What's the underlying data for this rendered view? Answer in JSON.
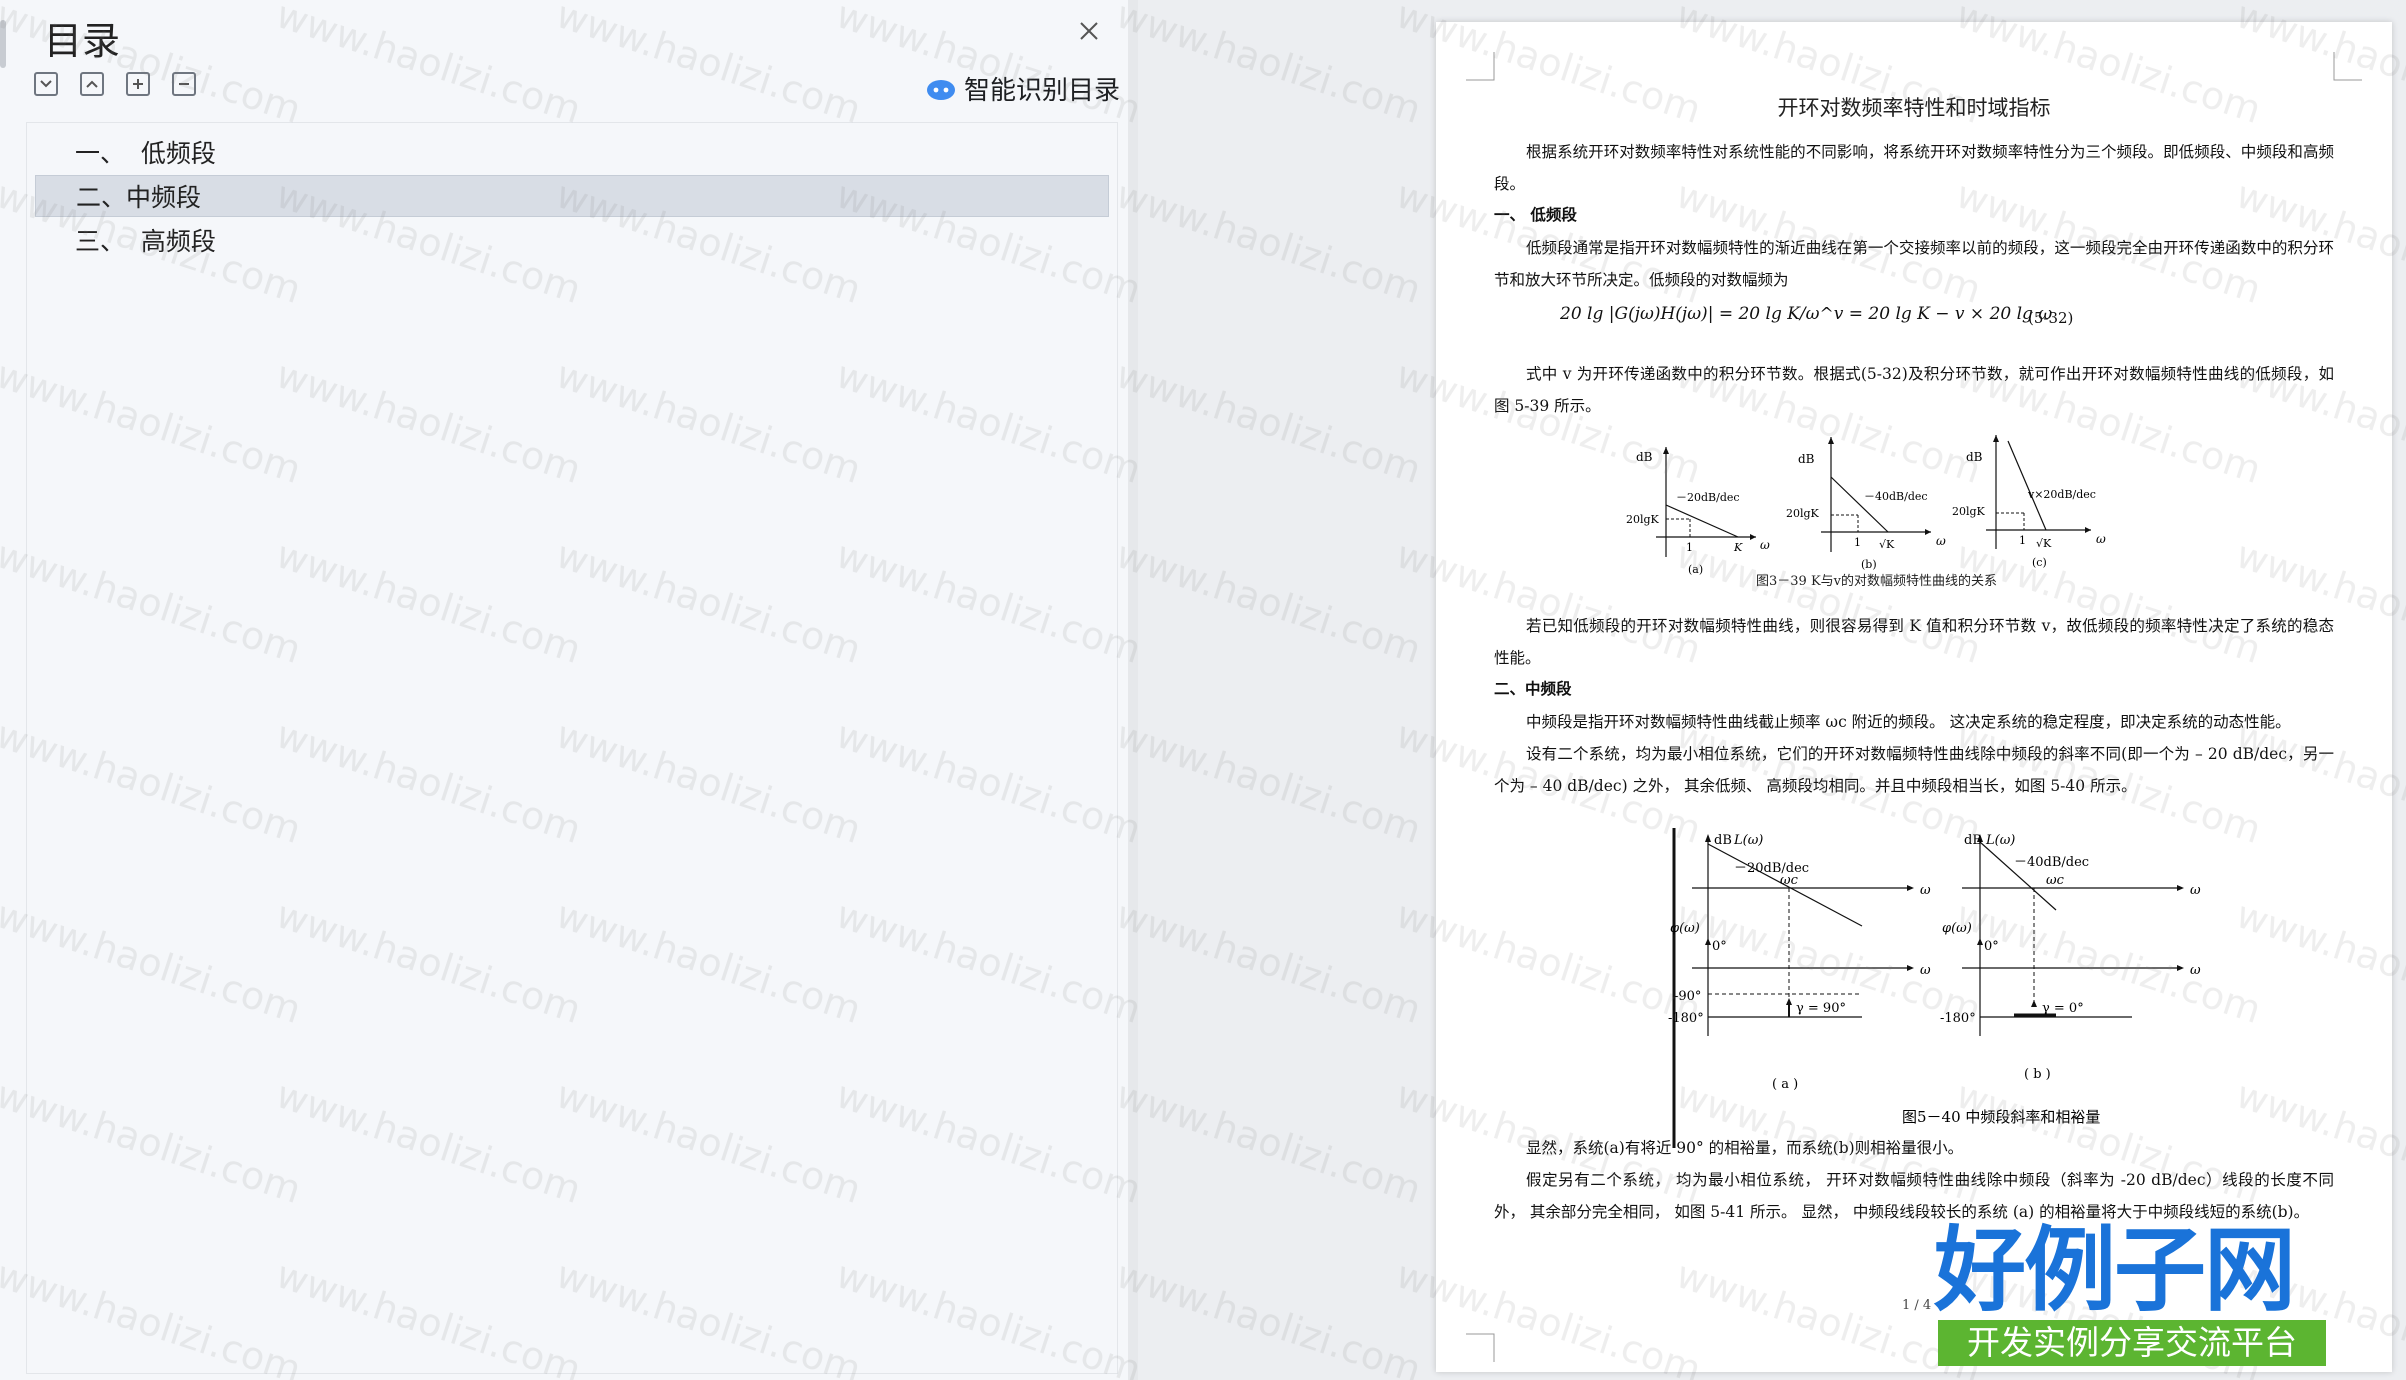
{
  "toc": {
    "title": "目录",
    "smart_toc_label": "智能识别目录",
    "items": [
      {
        "label": "一、  低频段"
      },
      {
        "label": "二、中频段"
      },
      {
        "label": "三、  高频段"
      }
    ],
    "active_index": 1
  },
  "document": {
    "title": "开环对数频率特性和时域指标",
    "intro": "根据系统开环对数频率特性对系统性能的不同影响，将系统开环对数频率特性分为三个频段。即低频段、中频段和高频段。",
    "h1": "一、  低频段",
    "p1": "低频段通常是指开环对数幅频特性的渐近曲线在第一个交接频率以前的频段，这一频段完全由开环传递函数中的积分环节和放大环节所决定。低频段的对数幅频为",
    "formula": "20 lg |G(jω)H(jω)| = 20 lg K/ω^v = 20 lg K − v × 20 lg ω",
    "eq_no": "(5-32)",
    "p2": "式中 v 为开环传递函数中的积分环节数。根据式(5-32)及积分环节数，就可作出开环对数幅频特性曲线的低频段，如图 5-39 所示。",
    "fig39": {
      "caption": "图3－39  K与v的对数幅频特性曲线的关系",
      "panels": [
        {
          "label": "(a)",
          "slope": "－20dB/dec",
          "y_label": "dB",
          "y_tick": "20lgK",
          "x_ticks": [
            "1",
            "K"
          ],
          "x_axis": "ω"
        },
        {
          "label": "(b)",
          "slope": "－40dB/dec",
          "y_label": "dB",
          "y_tick": "20lgK",
          "x_ticks": [
            "1",
            "√K"
          ],
          "x_axis": "ω"
        },
        {
          "label": "(c)",
          "slope": "v×20dB/dec",
          "y_label": "dB",
          "y_tick": "20lgK",
          "x_ticks": [
            "1",
            "√K"
          ],
          "x_axis": "ω"
        }
      ]
    },
    "p3": "若已知低频段的开环对数幅频特性曲线，则很容易得到 K 值和积分环节数 v，故低频段的频率特性决定了系统的稳态性能。",
    "h2": "二、中频段",
    "p4": "中频段是指开环对数幅频特性曲线截止频率 ωc 附近的频段。 这决定系统的稳定程度，即决定系统的动态性能。",
    "p5": "设有二个系统，均为最小相位系统，它们的开环对数幅频特性曲线除中频段的斜率不同(即一个为 – 20 dB/dec，另一个为 – 40 dB/dec) 之外，  其余低频、 高频段均相同。并且中频段相当长，如图 5-40  所示。",
    "fig40": {
      "caption": "图5－40  中频段斜率和相裕量",
      "panels": [
        {
          "label": "( a )",
          "mag_label": "dB",
          "L_label": "L(ω)",
          "slope": "－20dB/dec",
          "wc": "ωc",
          "phi_label": "φ(ω)",
          "zero": "0°",
          "m90": "-90°",
          "m180": "-180°",
          "gamma": "γ = 90°",
          "x_axis": "ω"
        },
        {
          "label": "( b )",
          "mag_label": "dB",
          "L_label": "L(ω)",
          "slope": "－40dB/dec",
          "wc": "ωc",
          "phi_label": "φ(ω)",
          "zero": "0°",
          "m180": "-180°",
          "gamma": "γ = 0°",
          "x_axis": "ω"
        }
      ]
    },
    "p6": "显然，系统(a)有将近 90° 的相裕量，而系统(b)则相裕量很小。",
    "p7": "假定另有二个系统，  均为最小相位系统，  开环对数幅频特性曲线除中频段（斜率为  -20 dB/dec）线段的长度不同外，  其余部分完全相同，  如图  5-41  所示。  显然，  中频段线段较长的系统 (a) 的相裕量将大于中频段线短的系统(b)。",
    "page_number": "1 / 4"
  },
  "watermark": "www.haolizi.com",
  "logo": {
    "main": "好例子网",
    "sub": "开发实例分享交流平台"
  },
  "colors": {
    "logo_blue": "#1a73d9",
    "logo_green": "#5cb531",
    "active_row": "#d8dde5"
  }
}
